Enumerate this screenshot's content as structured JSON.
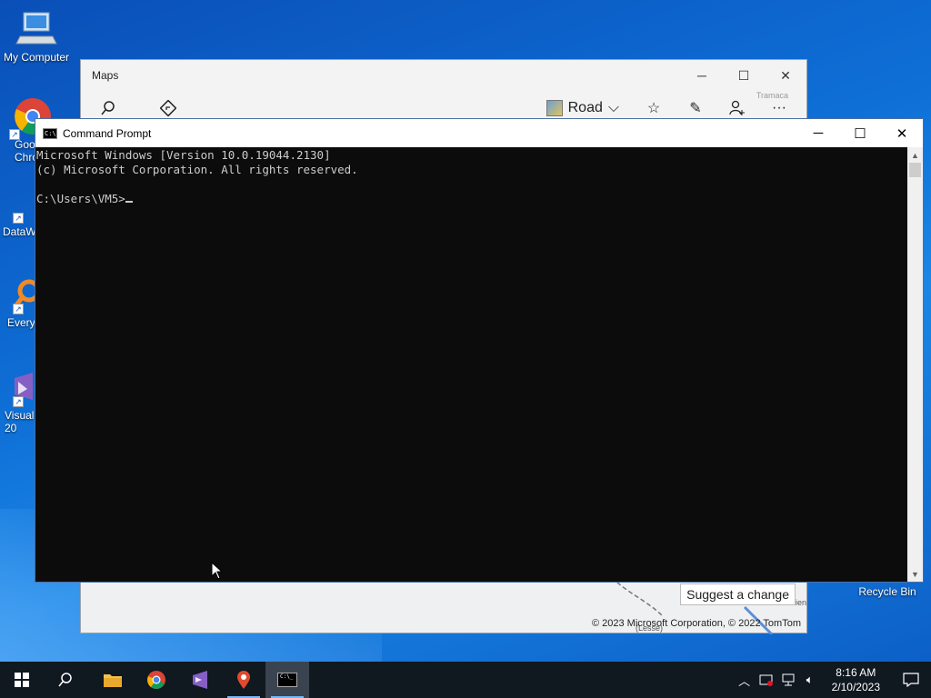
{
  "desktop": {
    "icons": [
      {
        "label": "My Computer",
        "icon": "computer-icon"
      },
      {
        "label": "Goo\nChro",
        "icon": "chrome-icon"
      },
      {
        "label": "DataW",
        "icon": "datawrapper-icon"
      },
      {
        "label": "Every",
        "icon": "everything-search-icon"
      },
      {
        "label": "Visual\n20",
        "icon": "visual-studio-icon"
      }
    ],
    "recycle_bin": "Recycle Bin"
  },
  "maps": {
    "title": "Maps",
    "toolbar": {
      "search_icon": "search-icon",
      "directions_icon": "directions-icon",
      "road_label": "Road",
      "favorites_icon": "favorites-icon",
      "ink_icon": "pen-icon",
      "account_icon": "person-add-icon",
      "more_icon": "more-icon"
    },
    "suggest_label": "Suggest a change",
    "copyright": "© 2023 Microsoft Corporation, © 2022 TomTom",
    "map_labels": [
      "Tramaca",
      "(Lesse)",
      "Gabien"
    ]
  },
  "cmd": {
    "title": "Command Prompt",
    "lines": [
      "Microsoft Windows [Version 10.0.19044.2130]",
      "(c) Microsoft Corporation. All rights reserved.",
      "",
      "C:\\Users\\VM5>"
    ]
  },
  "taskbar": {
    "apps": [
      "start-icon",
      "search-icon",
      "file-explorer-icon",
      "chrome-icon",
      "visual-studio-icon",
      "maps-icon",
      "command-prompt-icon"
    ],
    "time": "8:16 AM",
    "date": "2/10/2023"
  }
}
